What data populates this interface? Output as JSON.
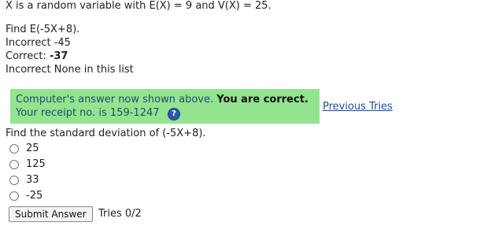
{
  "problem": {
    "statement": "X is a random variable with E(X) = 9 and V(X) = 25."
  },
  "part1": {
    "question": "Find E(-5X+8).",
    "incorrect_1": "Incorrect -45",
    "correct_prefix": "Correct: ",
    "correct_value": "-37",
    "incorrect_2": "Incorrect None in this list"
  },
  "feedback": {
    "message": "Computer's answer now shown above. ",
    "status": "You are correct.",
    "receipt": "Your receipt no. is 159-1247",
    "help_glyph": "?",
    "help_icon": "help-circle-icon",
    "background_color": "#93e38f",
    "previous_tries_link": "Previous Tries"
  },
  "part2": {
    "question": "Find the standard deviation of (-5X+8).",
    "options": [
      "25",
      "125",
      "33",
      "-25"
    ],
    "submit_label": "Submit Answer",
    "tries": "Tries 0/2"
  }
}
